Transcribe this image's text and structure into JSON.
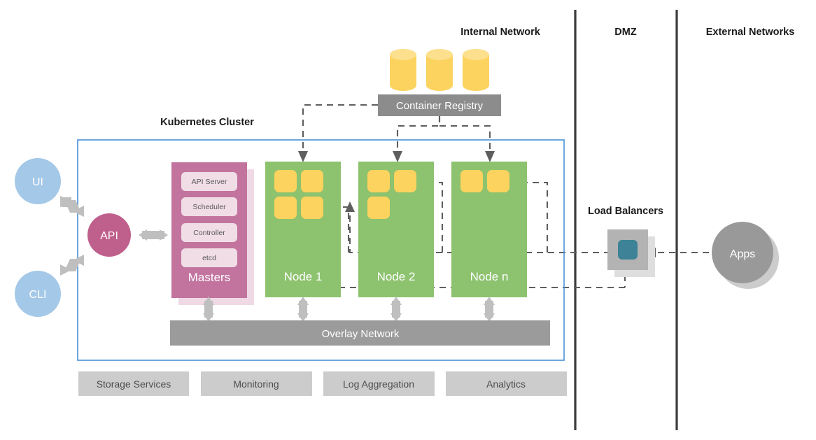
{
  "zones": [
    {
      "id": "internal-network",
      "label": "Internal Network"
    },
    {
      "id": "dmz",
      "label": "DMZ"
    },
    {
      "id": "external-networks",
      "label": "External Networks"
    }
  ],
  "cluster": {
    "label": "Kubernetes Cluster",
    "border_color": "#4a90d9"
  },
  "clients": [
    {
      "id": "ui",
      "label": "UI",
      "color": "#a4c8e8"
    },
    {
      "id": "cli",
      "label": "CLI",
      "color": "#a4c8e8"
    }
  ],
  "api": {
    "label": "API",
    "color": "#bf5f8c"
  },
  "masters": {
    "label": "Masters",
    "color": "#c2749f",
    "shadow_color": "#efd9e4",
    "components": [
      {
        "label": "API Server"
      },
      {
        "label": "Scheduler"
      },
      {
        "label": "Controller"
      },
      {
        "label": "etcd"
      }
    ]
  },
  "nodes": [
    {
      "id": "node-1",
      "label": "Node 1",
      "pods": 4,
      "color": "#8dc26f"
    },
    {
      "id": "node-2",
      "label": "Node 2",
      "pods": 3,
      "color": "#8dc26f"
    },
    {
      "id": "node-n",
      "label": "Node n",
      "pods": 2,
      "color": "#8dc26f"
    }
  ],
  "pod_color": "#fbd35e",
  "registry": {
    "label": "Container Registry",
    "color": "#8c8c8c",
    "cylinders": 3,
    "cylinder_color": "#fbd35e"
  },
  "overlay_network": {
    "label": "Overlay Network",
    "color": "#9b9b9b"
  },
  "platform_services": [
    {
      "id": "storage-services",
      "label": "Storage Services"
    },
    {
      "id": "monitoring",
      "label": "Monitoring"
    },
    {
      "id": "log-aggregation",
      "label": "Log Aggregation"
    },
    {
      "id": "analytics",
      "label": "Analytics"
    }
  ],
  "load_balancers": {
    "label": "Load Balancers",
    "box_color": "#b3b3b3",
    "shadow_color": "#dedede",
    "inner_color": "#3d8296"
  },
  "apps": {
    "label": "Apps",
    "color": "#999999",
    "shadow_color": "#cccccc"
  }
}
